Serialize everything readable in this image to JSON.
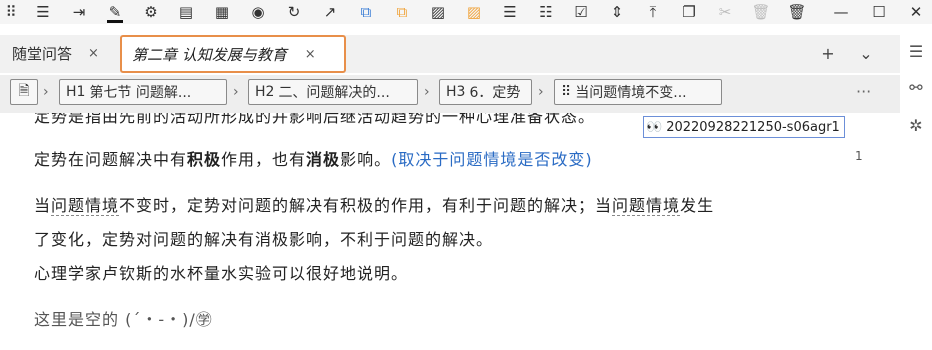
{
  "toolbar": {
    "icons": [
      "grid-icon",
      "sort-icon",
      "indent-icon",
      "highlight-icon",
      "bug-icon",
      "list-box-icon",
      "calendar-icon",
      "radio-icon",
      "refresh-icon",
      "external-link-icon",
      "link-blue-icon",
      "link-orange-icon",
      "image-icon",
      "image-orange-icon",
      "bullet-list-icon",
      "checklist-icon",
      "checkbox-icon",
      "align-center-icon",
      "vertical-align-icon",
      "copy-icon",
      "cut-icon",
      "trash-disabled-icon",
      "trash-icon",
      "minimize-icon",
      "maximize-icon",
      "close-icon"
    ]
  },
  "tabs": [
    {
      "label": "随堂问答",
      "close": "×"
    },
    {
      "label": "第二章 认知发展与教育",
      "close": "×"
    }
  ],
  "tabbar": {
    "add": "+",
    "dropdown": "⌄"
  },
  "breadcrumb": {
    "items": [
      {
        "level": "H1",
        "text": "第七节 问题解..."
      },
      {
        "level": "H2",
        "text": "二、问题解决的..."
      },
      {
        "level": "H3",
        "text": "6．定势"
      },
      {
        "level": "",
        "text": "当问题情境不变..."
      }
    ],
    "more": "···"
  },
  "tag": {
    "label": "20220928221250-s06agr1"
  },
  "content": {
    "cut_line": "定势是指由先前的活动所形成的并影响后继活动趋势的一种心理准备状态。",
    "p1_a": "定势在问题解决中有",
    "p1_b": "积极",
    "p1_c": "作用，也有",
    "p1_d": "消极",
    "p1_e": "影响。",
    "p1_f": "(取决于问题情境是否改变)",
    "count": "1",
    "p2_a": "当",
    "p2_b": "问题情境",
    "p2_c": "不变时，定势对问题的解决有积极的作用，有利于问题的解决；当",
    "p2_d": "问题情境",
    "p2_e": "发生",
    "p3": "了变化，定势对问题的解决有消极影响，不利于问题的解决。",
    "p4": "心理学家卢钦斯的水杯量水实验可以很好地说明。",
    "p5": "这里是空的 (´・-・)/㊫"
  },
  "colors": {
    "accent": "#e88f4a",
    "link": "#2a6bc4",
    "tag_border": "#6c8fd8"
  }
}
